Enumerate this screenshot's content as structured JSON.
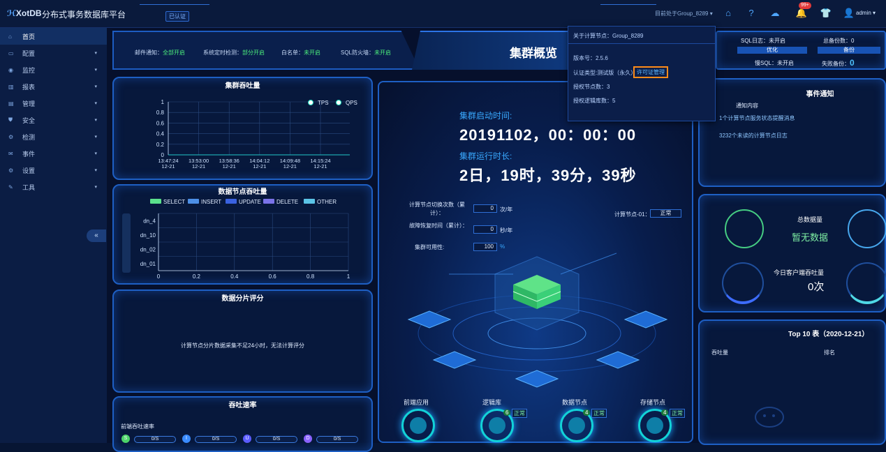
{
  "header": {
    "logo": "XotDB",
    "title": "分布式事务数据库平台",
    "cert_tag": "已认证",
    "current_node": "目前处于Group_8289",
    "notifications_badge": "99+",
    "user": "admin"
  },
  "sidebar": {
    "items": [
      {
        "label": "首页",
        "icon": "home-icon",
        "expandable": false,
        "active": true
      },
      {
        "label": "配置",
        "icon": "monitor-icon",
        "expandable": true
      },
      {
        "label": "监控",
        "icon": "eye-icon",
        "expandable": true
      },
      {
        "label": "报表",
        "icon": "chart-icon",
        "expandable": true
      },
      {
        "label": "管理",
        "icon": "database-icon",
        "expandable": true
      },
      {
        "label": "安全",
        "icon": "shield-icon",
        "expandable": true
      },
      {
        "label": "检测",
        "icon": "gear-icon",
        "expandable": true
      },
      {
        "label": "事件",
        "icon": "mail-icon",
        "expandable": true
      },
      {
        "label": "设置",
        "icon": "settings-icon",
        "expandable": true
      },
      {
        "label": "工具",
        "icon": "wrench-icon",
        "expandable": true
      }
    ],
    "collapse_label": "«"
  },
  "status_strip": {
    "email_label": "邮件通知：",
    "email_value": "全部开启",
    "timer_label": "系统定时检测：",
    "timer_value": "部分开启",
    "whitelist_label": "白名单：",
    "whitelist_value": "未开启",
    "firewall_label": "SQL防火墙：",
    "firewall_value": "未开启"
  },
  "center": {
    "title": "集群概览",
    "start_label": "集群启动时间:",
    "start_value": "20191102，00：00：00",
    "uptime_label": "集群运行时长:",
    "uptime_value": "2日，19时，39分，39秒",
    "switch_label": "计算节点切换次数（累计）：",
    "switch_value": "0",
    "switch_unit": "次/年",
    "recover_label": "故障恢复时间（累计）：",
    "recover_value": "0",
    "recover_unit": "秒/年",
    "availability_label": "集群可用性:",
    "availability_value": "100",
    "availability_unit": "%",
    "node01_label": "计算节点-01：",
    "node01_status": "正常",
    "bottom_nodes": [
      {
        "label": "前端应用"
      },
      {
        "label": "逻辑库",
        "count": "6",
        "status": "正常"
      },
      {
        "label": "数据节点",
        "count": "4",
        "status": "正常"
      },
      {
        "label": "存储节点",
        "count": "4",
        "status": "正常"
      }
    ]
  },
  "dropdown": {
    "about": "关于计算节点：Group_8289",
    "version": "版本号：2.5.6",
    "auth": "认证类型:测试版（永久）",
    "license_button": "许可证管理",
    "nodes": "授权节点数：3",
    "logic_dbs": "授权逻辑库数：5"
  },
  "right_stats": {
    "sql_log_label": "SQL日志：",
    "sql_log_value": "未开启",
    "backup_count_label": "总备份数：",
    "backup_count_value": "0",
    "optimize_tab": "优化",
    "backup_tab": "备份",
    "slow_sql_label": "慢SQL：",
    "slow_sql_value": "未开启",
    "failed_backup_label": "失败备份：",
    "failed_backup_value": "0"
  },
  "events": {
    "title": "事件通知",
    "col_header": "通知内容",
    "items": [
      "1个计算节点服务状态提醒消息",
      "3232个未读的计算节点日志"
    ]
  },
  "data_volume": {
    "title": "总数据量",
    "value": "暂无数据",
    "today_label": "今日客户端吞吐量",
    "today_value": "0次"
  },
  "top10": {
    "title": "Top 10 表（2020-12-21）",
    "col1": "吞吐量",
    "col2": "排名"
  },
  "cluster_throughput": {
    "title": "集群吞吐量"
  },
  "node_throughput": {
    "title": "数据节点吞吐量"
  },
  "shard_score": {
    "title": "数据分片评分",
    "message": "计算节点分片数据采集不足24小时，无法计算评分"
  },
  "rate": {
    "title": "吞吐速率",
    "subtitle": "前端吞吐速率",
    "items": [
      {
        "letter": "S",
        "value": "0/S",
        "color": "#4cd46a"
      },
      {
        "letter": "I",
        "value": "0/S",
        "color": "#3a8bff"
      },
      {
        "letter": "U",
        "value": "0/S",
        "color": "#5b5cff"
      },
      {
        "letter": "D",
        "value": "0/S",
        "color": "#8a63ff"
      }
    ]
  },
  "chart_data": [
    {
      "type": "line",
      "title": "集群吞吐量",
      "x": [
        "13:47:24\n12-21",
        "13:53:00\n12-21",
        "13:58:36\n12-21",
        "14:04:12\n12-21",
        "14:09:48\n12-21",
        "14:15:24\n12-21"
      ],
      "series": [
        {
          "name": "TPS",
          "values": [
            0,
            0,
            0,
            0,
            0,
            0
          ]
        },
        {
          "name": "QPS",
          "values": [
            0,
            0,
            0,
            0,
            0,
            0
          ]
        }
      ],
      "ylim": [
        0,
        1
      ],
      "yticks": [
        "0",
        "0.2",
        "0.4",
        "0.6",
        "0.8",
        "1"
      ],
      "grid": true,
      "legend": "top-right"
    },
    {
      "type": "bar",
      "orientation": "horizontal",
      "title": "数据节点吞吐量",
      "categories": [
        "dn_4",
        "dn_10",
        "dn_02",
        "dn_01"
      ],
      "series": [
        {
          "name": "SELECT",
          "color": "#5be08c",
          "values": [
            0,
            0,
            0,
            0
          ]
        },
        {
          "name": "INSERT",
          "color": "#4d8fe6",
          "values": [
            0,
            0,
            0,
            0
          ]
        },
        {
          "name": "UPDATE",
          "color": "#3a62e0",
          "values": [
            0,
            0,
            0,
            0
          ]
        },
        {
          "name": "DELETE",
          "color": "#7a73e8",
          "values": [
            0,
            0,
            0,
            0
          ]
        },
        {
          "name": "OTHER",
          "color": "#5bc3e6",
          "values": [
            0,
            0,
            0,
            0
          ]
        }
      ],
      "xlim": [
        0,
        1
      ],
      "xticks": [
        "0",
        "0.2",
        "0.4",
        "0.6",
        "0.8",
        "1"
      ],
      "grid": true,
      "legend": "top"
    }
  ]
}
